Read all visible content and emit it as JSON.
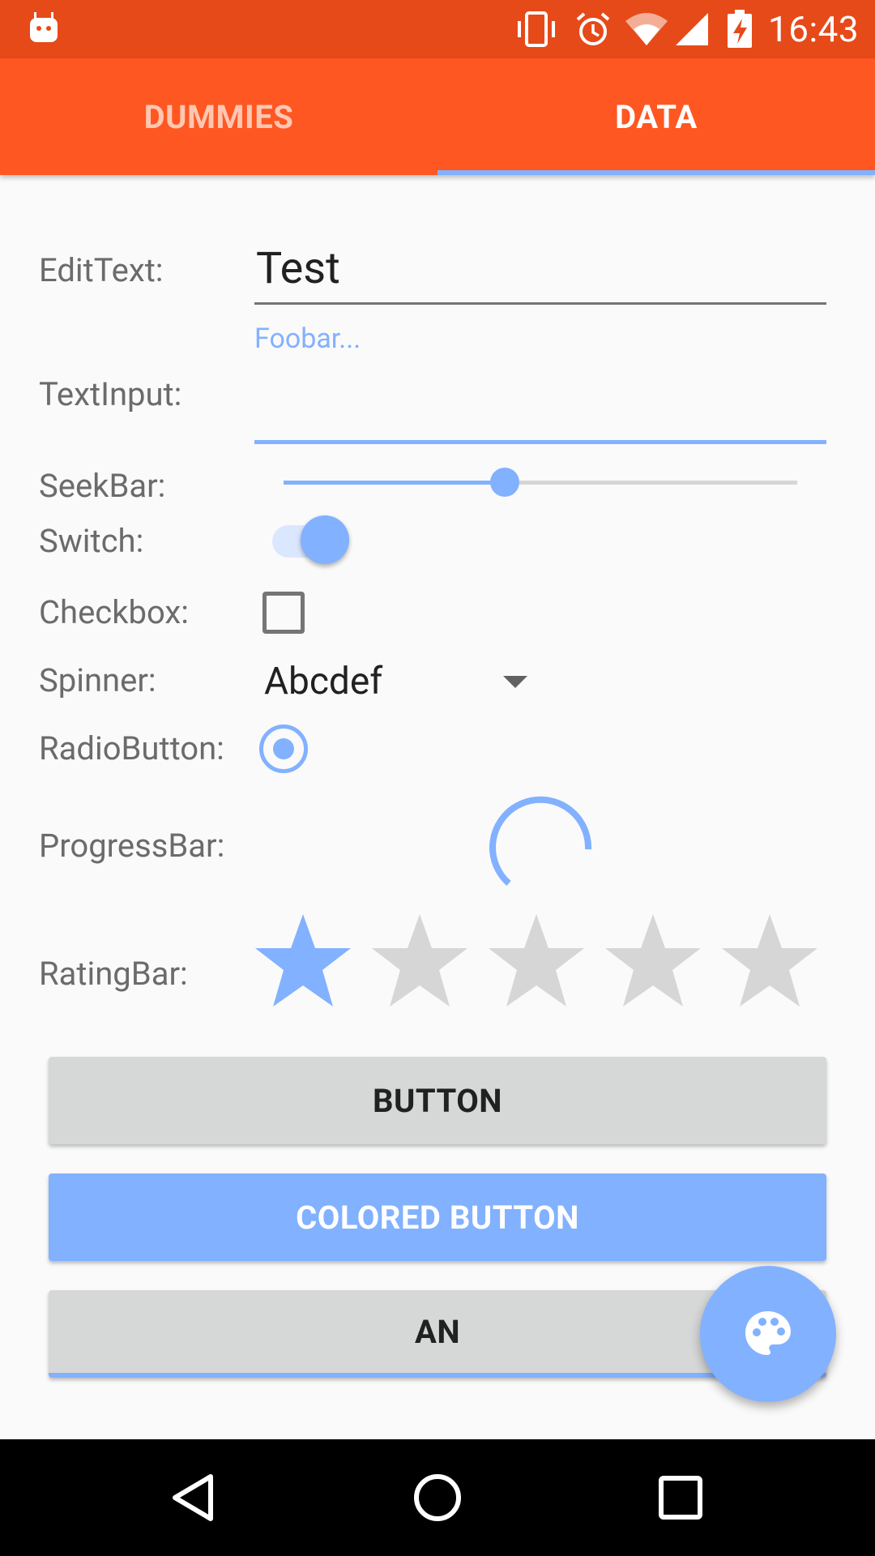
{
  "status_bar": {
    "time": "16:43",
    "icons": [
      "android-debug-icon",
      "vibrate-icon",
      "alarm-icon",
      "wifi-icon",
      "cell-signal-icon",
      "battery-charging-icon"
    ]
  },
  "tabs": [
    {
      "label": "DUMMIES",
      "selected": false
    },
    {
      "label": "DATA",
      "selected": true
    }
  ],
  "form": {
    "edittext": {
      "label": "EditText:",
      "value": "Test"
    },
    "textinput": {
      "label": "TextInput:",
      "hint": "Foobar..."
    },
    "seekbar": {
      "label": "SeekBar:",
      "progress": 0.43
    },
    "switch": {
      "label": "Switch:",
      "checked": true
    },
    "checkbox": {
      "label": "Checkbox:",
      "checked": false
    },
    "spinner": {
      "label": "Spinner:",
      "value": "Abcdef"
    },
    "radiobutton": {
      "label": "RadioButton:",
      "checked": true
    },
    "progressbar": {
      "label": "ProgressBar:"
    },
    "ratingbar": {
      "label": "RatingBar:",
      "rating": 1,
      "max": 5
    }
  },
  "buttons": {
    "button": "BUTTON",
    "colored_button": "COLORED BUTTON",
    "an": "AN"
  },
  "fab": {
    "icon": "palette-icon"
  },
  "nav_bar": {
    "icons": [
      "back-icon",
      "home-icon",
      "recents-icon"
    ]
  },
  "colors": {
    "status_bar": "#e64a19",
    "primary": "#ff5722",
    "accent": "#82b1ff",
    "inactive_tab_text": "#ffc7b2",
    "button_gray": "#d6d7d7"
  }
}
